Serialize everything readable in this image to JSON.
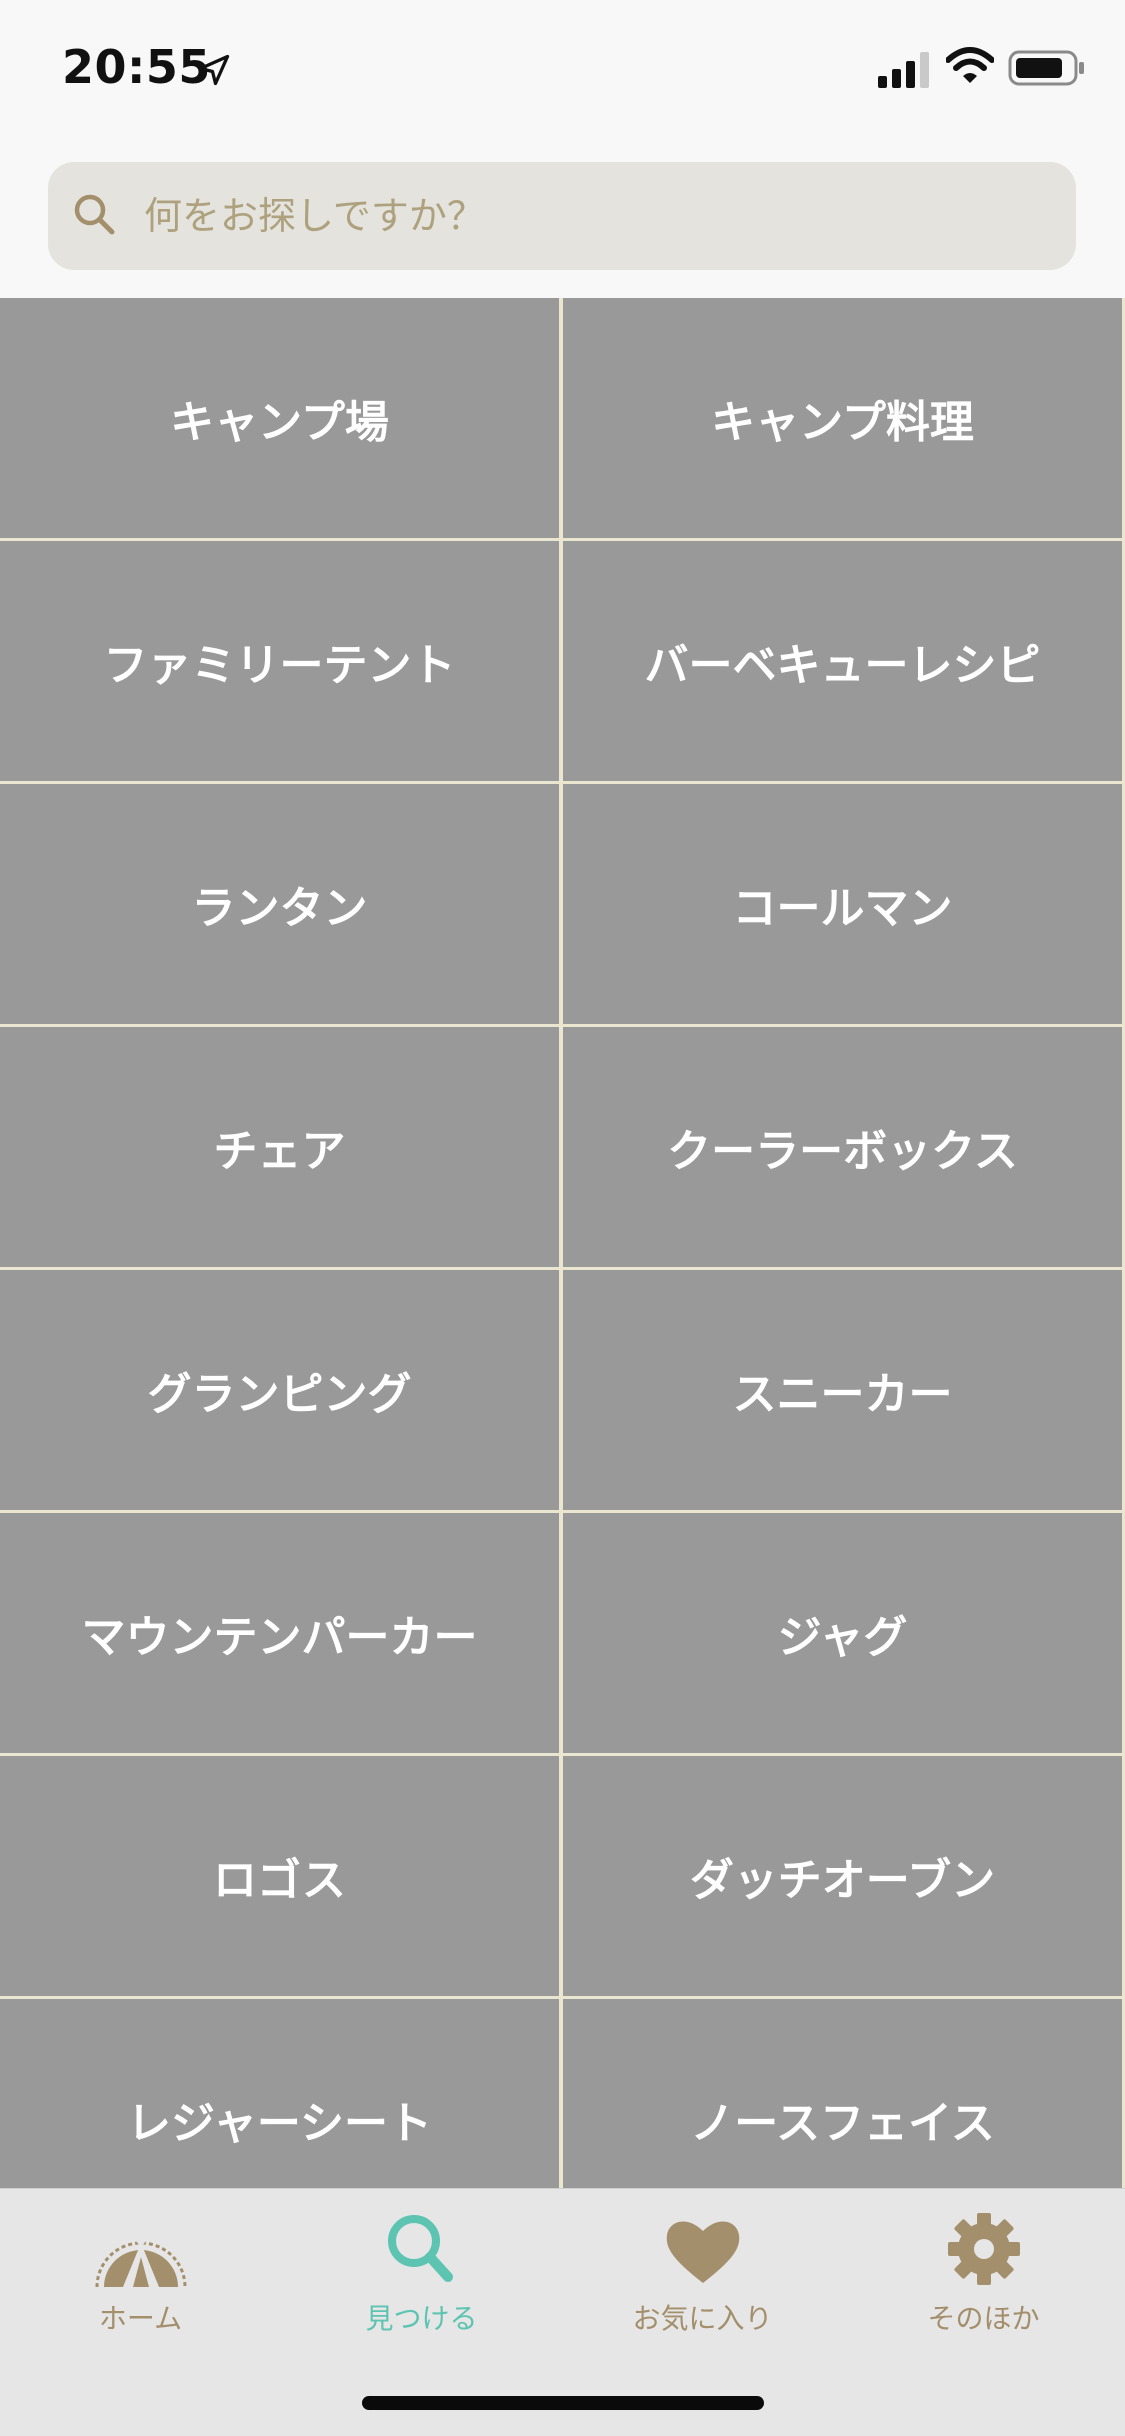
{
  "status_bar": {
    "time": "20:55",
    "icons": [
      "location-arrow-icon",
      "signal-icon",
      "wifi-icon",
      "battery-icon"
    ]
  },
  "search": {
    "placeholder": "何をお探しですか？",
    "value": ""
  },
  "categories": [
    "キャンプ場",
    "キャンプ料理",
    "ファミリーテント",
    "バーベキューレシピ",
    "ランタン",
    "コールマン",
    "チェア",
    "クーラーボックス",
    "グランピング",
    "スニーカー",
    "マウンテンパーカー",
    "ジャグ",
    "ロゴス",
    "ダッチオーブン",
    "レジャーシート",
    "ノースフェイス"
  ],
  "tab_bar": {
    "tabs": [
      {
        "label": "ホーム",
        "icon": "tent-badge-icon",
        "active": false
      },
      {
        "label": "見つける",
        "icon": "search-icon",
        "active": true
      },
      {
        "label": "お気に入り",
        "icon": "heart-icon",
        "active": false
      },
      {
        "label": "そのほか",
        "icon": "gear-icon",
        "active": false
      }
    ]
  },
  "colors": {
    "accent_active": "#5cc4b0",
    "accent_inactive": "#a48f6c",
    "cell_background": "#999999",
    "grid_gap": "#ebe6cf",
    "search_background": "#e4e3de",
    "placeholder": "#aea27e"
  }
}
